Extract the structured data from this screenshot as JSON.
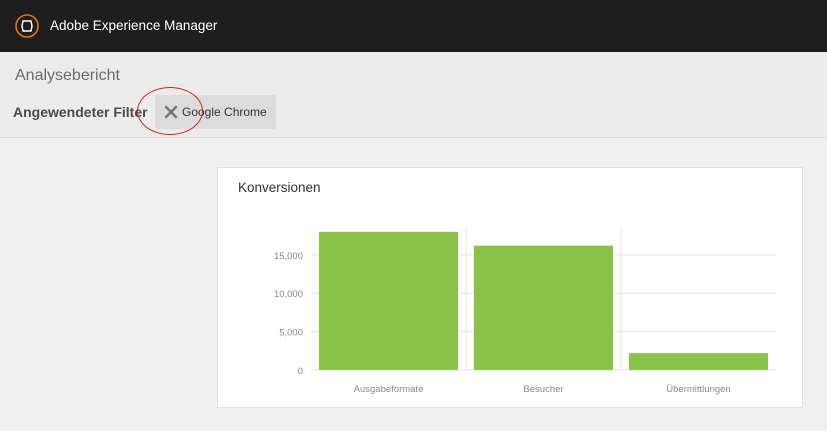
{
  "app": {
    "title": "Adobe Experience Manager",
    "logo_icon": "aem-logo-icon"
  },
  "page": {
    "title": "Analysebericht"
  },
  "filter": {
    "label": "Angewendeter Filter",
    "chips": [
      {
        "label": "Google Chrome",
        "remove_icon": "close-icon"
      }
    ]
  },
  "colors": {
    "topbar": "#1e1e1e",
    "logo_accent": "#e8711a",
    "bar": "#8bc34a",
    "annotation": "#e02020"
  },
  "chart_data": {
    "type": "bar",
    "title": "Konversionen",
    "categories": [
      "Ausgabeformate",
      "Besucher",
      "Übermittlungen"
    ],
    "values": [
      18000,
      16200,
      2200
    ],
    "ylim": [
      0,
      18500
    ],
    "yticks": [
      0,
      5000,
      10000,
      15000
    ],
    "ytick_labels": [
      "0",
      "5,000",
      "10,000",
      "15,000"
    ],
    "grid": true,
    "xlabel": "",
    "ylabel": ""
  }
}
